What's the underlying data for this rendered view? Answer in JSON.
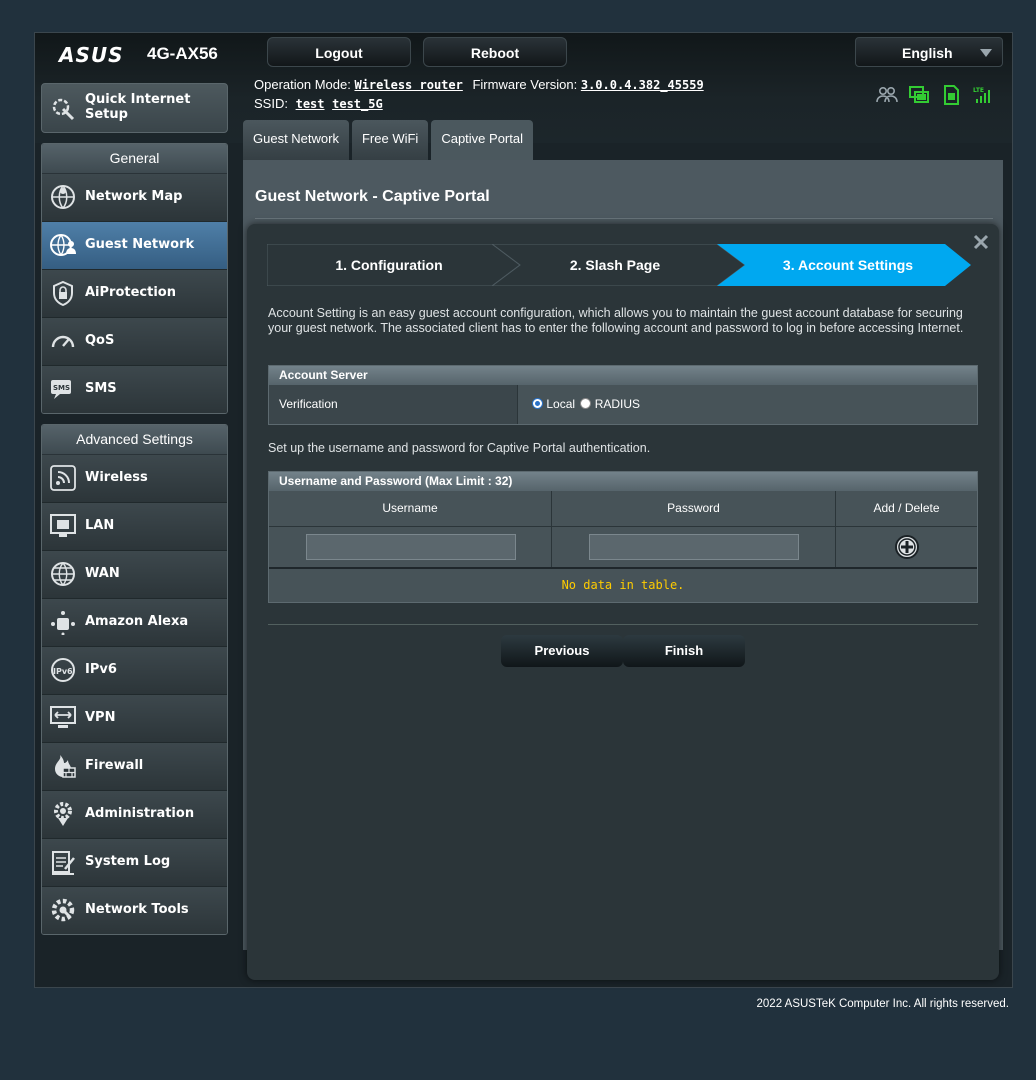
{
  "brand": {
    "logo": "ASUS",
    "model": "4G-AX56"
  },
  "topbar": {
    "logout_label": "Logout",
    "reboot_label": "Reboot",
    "language": "English"
  },
  "status": {
    "op_mode_label": "Operation Mode:",
    "op_mode_value": "Wireless router",
    "fw_label": "Firmware Version:",
    "fw_value": "3.0.0.4.382_45559",
    "ssid_label": "SSID:",
    "ssid_values": [
      "test",
      "test_5G"
    ]
  },
  "sidebar": {
    "quick_setup": "Quick Internet Setup",
    "general_header": "General",
    "general_items": [
      {
        "label": "Network Map",
        "icon": "network-map-icon"
      },
      {
        "label": "Guest Network",
        "icon": "guest-network-icon",
        "active": true
      },
      {
        "label": "AiProtection",
        "icon": "shield-icon"
      },
      {
        "label": "QoS",
        "icon": "gauge-icon"
      },
      {
        "label": "SMS",
        "icon": "sms-icon"
      }
    ],
    "advanced_header": "Advanced Settings",
    "advanced_items": [
      {
        "label": "Wireless",
        "icon": "wireless-icon"
      },
      {
        "label": "LAN",
        "icon": "lan-icon"
      },
      {
        "label": "WAN",
        "icon": "globe-icon"
      },
      {
        "label": "Amazon Alexa",
        "icon": "alexa-icon"
      },
      {
        "label": "IPv6",
        "icon": "ipv6-icon"
      },
      {
        "label": "VPN",
        "icon": "vpn-icon"
      },
      {
        "label": "Firewall",
        "icon": "firewall-icon"
      },
      {
        "label": "Administration",
        "icon": "gear-icon"
      },
      {
        "label": "System Log",
        "icon": "log-icon"
      },
      {
        "label": "Network Tools",
        "icon": "tools-icon"
      }
    ]
  },
  "tabs": [
    "Guest Network",
    "Free WiFi",
    "Captive Portal"
  ],
  "page": {
    "title": "Guest Network - Captive Portal"
  },
  "wizard": {
    "steps": [
      "1. Configuration",
      "2. Slash Page",
      "3. Account Settings"
    ],
    "active_step": 3,
    "intro": "Account Setting is an easy guest account configuration, which allows you to maintain the guest account database for securing your guest network. The associated client has to enter the following account and password to log in before accessing Internet.",
    "account_server_header": "Account Server",
    "verification_label": "Verification",
    "verification_options": [
      "Local",
      "RADIUS"
    ],
    "verification_selected": "Local",
    "setup_text": "Set up the username and password for Captive Portal authentication.",
    "users_header": "Username and Password (Max Limit : 32)",
    "columns": [
      "Username",
      "Password",
      "Add / Delete"
    ],
    "username_value": "",
    "password_value": "",
    "empty_text": "No data in table.",
    "previous_label": "Previous",
    "finish_label": "Finish"
  },
  "footer": "2022 ASUSTeK Computer Inc. All rights reserved.",
  "colors": {
    "accent": "#00a8f0",
    "active_nav": "#4f7fa8",
    "nodata": "#ffcc00",
    "status_green": "#33cc33"
  }
}
